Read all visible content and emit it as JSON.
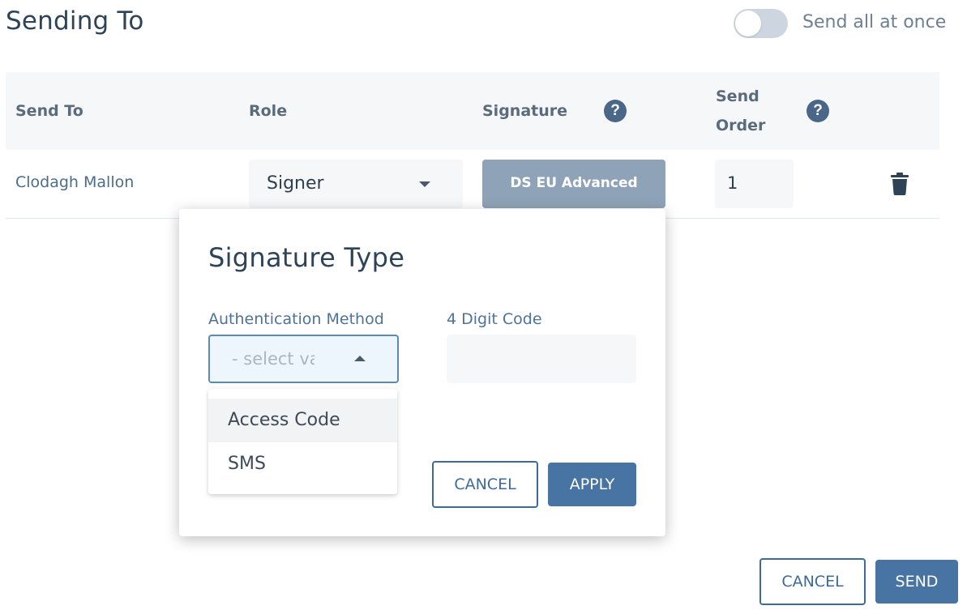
{
  "header": {
    "title": "Sending To",
    "toggle_label": "Send all at once",
    "toggle_on": false
  },
  "table": {
    "headers": {
      "send_to": "Send To",
      "role": "Role",
      "signature": "Signature",
      "send_order_line1": "Send",
      "send_order_line2": "Order"
    },
    "row": {
      "recipient": "Clodagh Mallon",
      "role": "Signer",
      "signature": "DS EU Advanced",
      "send_order": "1"
    }
  },
  "icons": {
    "help": "?",
    "help_icon_name": "question-circle-icon",
    "trash_icon_name": "trash-icon",
    "caret_down": "chevron-down-icon",
    "caret_up": "chevron-up-icon"
  },
  "modal": {
    "title": "Signature Type",
    "auth_label": "Authentication Method",
    "auth_placeholder": "- select value -",
    "code_label": "4 Digit Code",
    "code_value": "",
    "options": [
      "Access Code",
      "SMS"
    ],
    "cancel_label": "CANCEL",
    "apply_label": "APPLY"
  },
  "footer": {
    "cancel_label": "CANCEL",
    "send_label": "SEND"
  },
  "colors": {
    "accent": "#4874a3",
    "signature_button": "#8fa3b8",
    "help_icon": "#4a6787",
    "focus_border": "#5b8ab8"
  }
}
